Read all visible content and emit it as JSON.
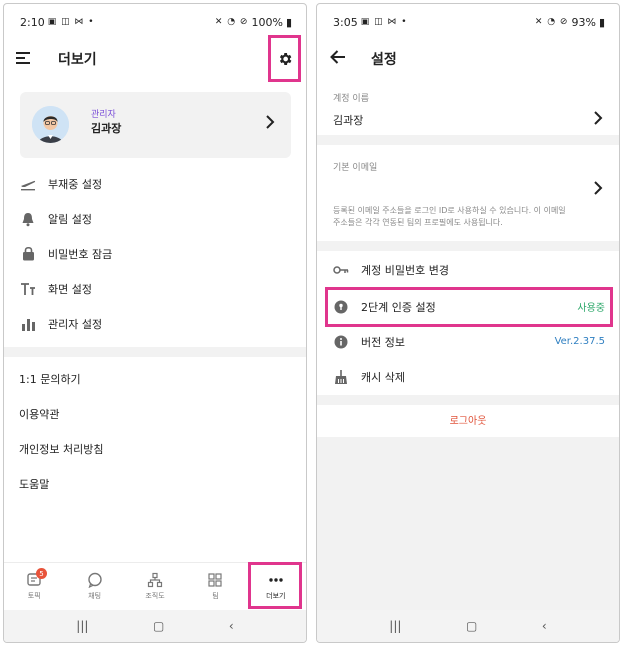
{
  "left": {
    "status": {
      "time": "2:10",
      "glyphs": "▣ ◫ ⋈ •",
      "right_icons": "✕ ◔ ⊘",
      "battery": "100%"
    },
    "title": "더보기",
    "profile": {
      "role": "관리자",
      "name": "김과장"
    },
    "menu": [
      {
        "icon": "airplane-icon",
        "label": "부재중 설정"
      },
      {
        "icon": "bell-icon",
        "label": "알림 설정"
      },
      {
        "icon": "lock-icon",
        "label": "비밀번호 잠금"
      },
      {
        "icon": "text-size-icon",
        "label": "화면 설정"
      },
      {
        "icon": "bar-chart-icon",
        "label": "관리자 설정"
      }
    ],
    "links": [
      "1:1 문의하기",
      "이용약관",
      "개인정보 처리방침",
      "도움말"
    ],
    "nav": [
      {
        "icon": "topic-icon",
        "label": "토픽",
        "badge": "5"
      },
      {
        "icon": "chat-icon",
        "label": "채팅"
      },
      {
        "icon": "org-chart-icon",
        "label": "조직도"
      },
      {
        "icon": "grid-icon",
        "label": "팀"
      },
      {
        "icon": "more-dots-icon",
        "label": "더보기"
      }
    ]
  },
  "right": {
    "status": {
      "time": "3:05",
      "glyphs": "▣ ◫ ⋈ •",
      "right_icons": "✕ ◔ ⊘",
      "battery": "93%"
    },
    "title": "설정",
    "account": {
      "label": "계정 이름",
      "value": "김과장"
    },
    "email": {
      "label": "기본 이메일",
      "desc": "등록된 이메일 주소들을 로그인 ID로 사용하실 수 있습니다. 이 이메일 주소들은 각각 연동된 팀의 프로필에도 사용됩니다."
    },
    "items": [
      {
        "icon": "key-icon",
        "label": "계정 비밀번호 변경",
        "value": ""
      },
      {
        "icon": "two-factor-icon",
        "label": "2단계 인증 설정",
        "value": "사용중"
      },
      {
        "icon": "info-icon",
        "label": "버전 정보",
        "value": "Ver.2.37.5"
      },
      {
        "icon": "broom-icon",
        "label": "캐시 삭제",
        "value": ""
      }
    ],
    "logout": "로그아웃"
  },
  "colors": {
    "highlight": "#e0358d",
    "in_use": "#2ea86b",
    "version": "#2f7fc1",
    "logout": "#e0533a",
    "role": "#7b4fd8"
  }
}
